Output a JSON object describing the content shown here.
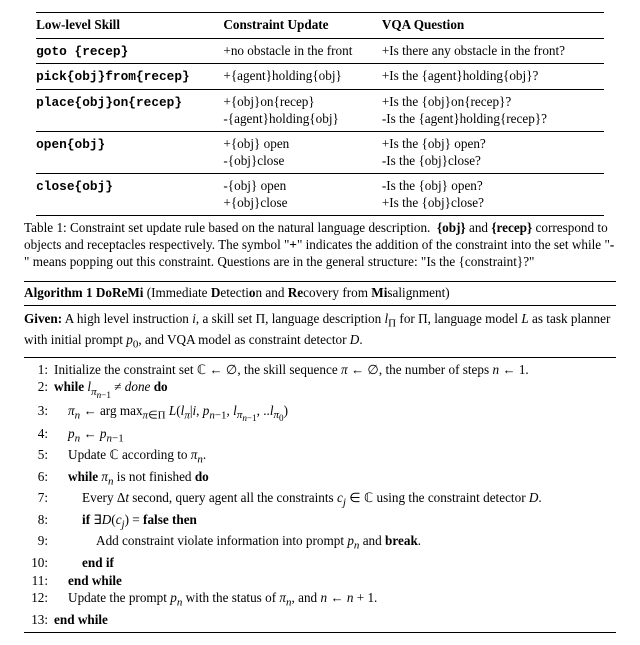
{
  "table": {
    "headers": [
      "Low-level Skill",
      "Constraint Update",
      "VQA Question"
    ],
    "rows": [
      {
        "skill": "goto {recep}",
        "update": "+no obstacle in the front",
        "question": "+Is there any obstacle in the front?"
      },
      {
        "skill": "pick{obj}from{recep}",
        "update": "+{agent}holding{obj}",
        "question": "+Is the {agent}holding{obj}?"
      },
      {
        "skill": "place{obj}on{recep}",
        "update": "+{obj}on{recep}\n-{agent}holding{obj}",
        "question": "+Is the {obj}on{recep}?\n-Is the {agent}holding{recep}?"
      },
      {
        "skill": "open{obj}",
        "update": "+{obj} open\n-{obj}close",
        "question": "+Is the {obj} open?\n-Is the {obj}close?"
      },
      {
        "skill": "close{obj}",
        "update": "-{obj} open\n+{obj}close",
        "question": "-Is the {obj} open?\n+Is the {obj}close?"
      }
    ]
  },
  "caption": {
    "label": "Table 1:",
    "text": "Constraint set update rule based on the natural language description.   {obj} and {recep} correspond to objects and receptacles respectively. The symbol \"+\" indicates the addition of the constraint into the set while \"-\" means popping out this constraint. Questions are in the general structure: \"Is the {constraint}?\""
  },
  "algorithm": {
    "title_label": "Algorithm 1",
    "title_name": "DoReMi",
    "title_paren": "(Immediate Detection and Recovery from Misalignment)",
    "given_label": "Given:",
    "given_text": " A high level instruction i, a skill set Π, language description l_Π for Π, language model L as task planner with initial prompt p₀, and VQA model as constraint detector D.",
    "lines": [
      {
        "no": "1:",
        "indent": 0,
        "text": "Initialize the constraint set ℂ ← ∅, the skill sequence π ← ∅, the number of steps n ← 1."
      },
      {
        "no": "2:",
        "indent": 0,
        "text": "while l_{π_{n−1}} ≠ done do",
        "bold": [
          "while",
          "do"
        ]
      },
      {
        "no": "3:",
        "indent": 1,
        "text": "π_n ← arg max_{π∈Π} L(l_π | i, p_{n−1}, l_{π_{n−1}}, .. l_{π₀})"
      },
      {
        "no": "4:",
        "indent": 1,
        "text": "p_n ← p_{n−1}"
      },
      {
        "no": "5:",
        "indent": 1,
        "text": "Update ℂ according to π_n."
      },
      {
        "no": "6:",
        "indent": 1,
        "text": "while π_n is not finished do",
        "bold": [
          "while",
          "do"
        ]
      },
      {
        "no": "7:",
        "indent": 2,
        "text": "Every Δt second, query agent all the constraints c_j ∈ ℂ using the constraint detector D."
      },
      {
        "no": "8:",
        "indent": 2,
        "text": "if ∃D(c_j) = false then",
        "bold": [
          "if",
          "then",
          "false"
        ]
      },
      {
        "no": "9:",
        "indent": 3,
        "text": "Add constraint violate information into prompt p_n and break.",
        "bold": [
          "break"
        ]
      },
      {
        "no": "10:",
        "indent": 2,
        "text": "end if",
        "bold": [
          "end if"
        ]
      },
      {
        "no": "11:",
        "indent": 1,
        "text": "end while",
        "bold": [
          "end while"
        ]
      },
      {
        "no": "12:",
        "indent": 1,
        "text": "Update the prompt p_n with the status of π_n, and n ← n + 1."
      },
      {
        "no": "13:",
        "indent": 0,
        "text": "end while",
        "bold": [
          "end while"
        ]
      }
    ]
  }
}
